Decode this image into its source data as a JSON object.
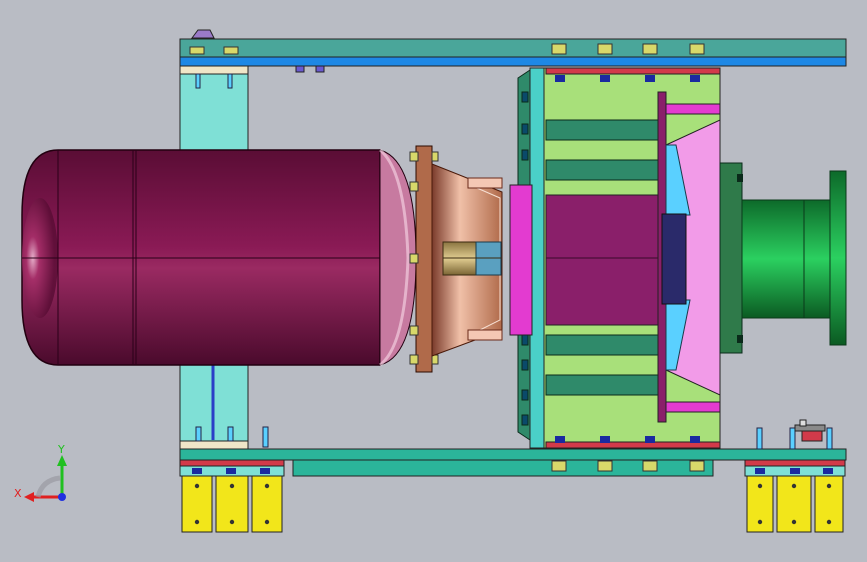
{
  "viewport": {
    "background": "#b9bcc4"
  },
  "colors": {
    "frame_blue": "#1e88e5",
    "frame_green": "#2bb59a",
    "plate_cyan": "#7fe0d6",
    "motor_maroon": "#7a1447",
    "flange_copper": "#c77a5a",
    "coupling_tan": "#c9b27a",
    "rotor_purple": "#8a1f6a",
    "rotor_magenta": "#e33bd0",
    "stator_lime": "#a8e07a",
    "fins_teal": "#2f8a6a",
    "shaft_green": "#1faa4a",
    "feet_yellow": "#f2e61a",
    "bolt_yellow": "#d8d86a",
    "bolt_blue": "#2a3fc7",
    "red_strip": "#d23a4a"
  },
  "view_triad": {
    "x_label": "X",
    "y_label": "Y",
    "x_axis_color": "#e02020",
    "y_axis_color": "#20c020",
    "z_axis_color": "#2030e0"
  }
}
